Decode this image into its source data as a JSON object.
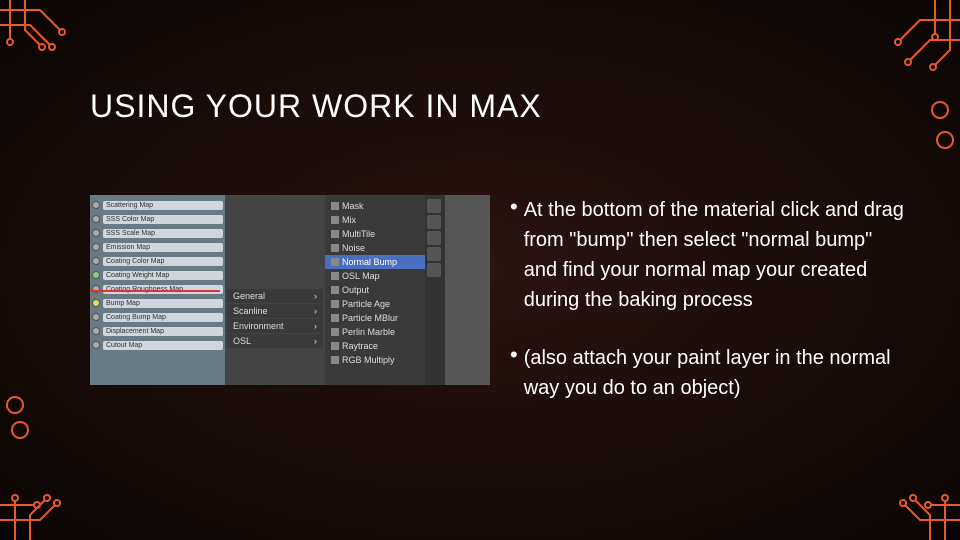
{
  "title": "USING YOUR WORK IN MAX",
  "bullets": {
    "item1": "At the bottom of the material click and drag from \"bump\" then select \"normal bump\" and find your normal map your created during the baking process",
    "item2": "(also attach your paint layer in the normal way you do to an object)"
  },
  "panel": {
    "slots": [
      "Scattering Map",
      "SSS Color Map",
      "SSS Scale Map",
      "Emission Map",
      "Coating Color Map",
      "Coating Weight Map",
      "Coating Roughness Map",
      "Bump Map",
      "Coating Bump Map",
      "Displacement Map",
      "Cutout Map"
    ],
    "submenu": [
      "General",
      "Scanline",
      "Environment",
      "OSL"
    ],
    "menu": [
      "Mask",
      "Mix",
      "MultiTile",
      "Noise",
      "Normal Bump",
      "OSL Map",
      "Output",
      "Particle Age",
      "Particle MBlur",
      "Perlin Marble",
      "Raytrace",
      "RGB Multiply"
    ]
  }
}
